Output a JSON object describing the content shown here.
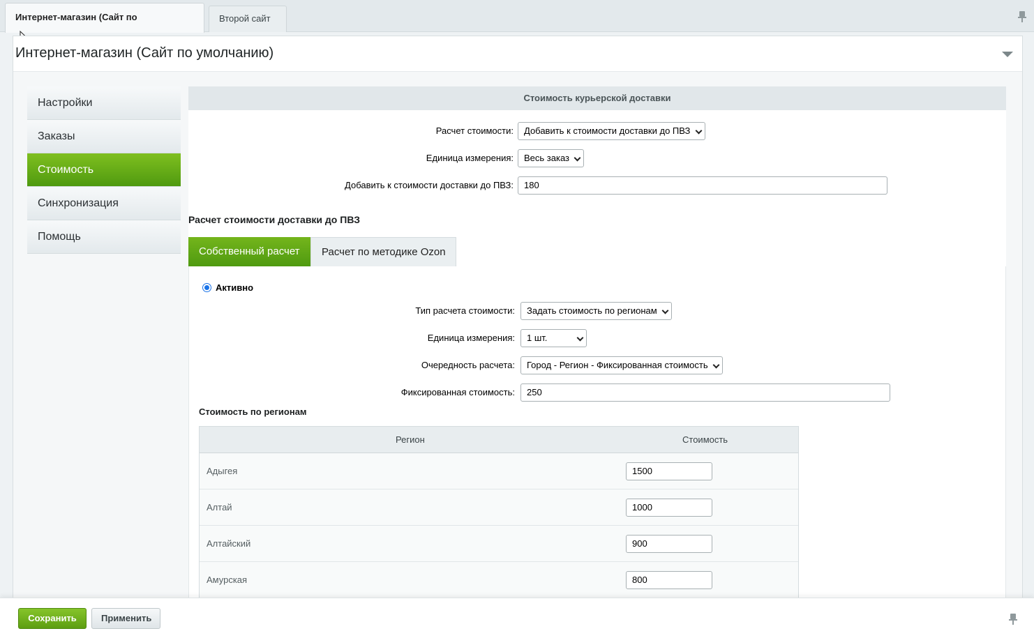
{
  "site_tabs": [
    {
      "label": "Интернет-магазин (Сайт по умолчанию)",
      "active": true
    },
    {
      "label": "Второй сайт",
      "active": false
    }
  ],
  "panel": {
    "title": "Интернет-магазин (Сайт по умолчанию)"
  },
  "side_menu": [
    {
      "label": "Настройки"
    },
    {
      "label": "Заказы"
    },
    {
      "label": "Стоимость",
      "active": true
    },
    {
      "label": "Синхронизация"
    },
    {
      "label": "Помощь"
    }
  ],
  "courier": {
    "title": "Стоимость курьерской доставки",
    "calc_label": "Расчет стоимости:",
    "calc_value": "Добавить к стоимости доставки до ПВЗ",
    "unit_label": "Единица измерения:",
    "unit_value": "Весь заказ",
    "add_label": "Добавить к стоимости доставки до ПВЗ:",
    "add_value": "180"
  },
  "pvz": {
    "title": "Расчет стоимости доставки до ПВЗ",
    "tabs": [
      {
        "label": "Собственный расчет",
        "active": true
      },
      {
        "label": "Расчет по методике Ozon",
        "active": false
      }
    ],
    "active_label": "Активно",
    "type_label": "Тип расчета стоимости:",
    "type_value": "Задать стоимость по регионам",
    "unit_label": "Единица измерения:",
    "unit_value": "1 шт.",
    "order_label": "Очередность расчета:",
    "order_value": "Город - Регион - Фиксированная стоимость",
    "fixed_label": "Фиксированная стоимость:",
    "fixed_value": "250",
    "regions_title": "Стоимость по регионам",
    "table": {
      "headers": [
        "Регион",
        "Стоимость"
      ],
      "rows": [
        {
          "region": "Адыгея",
          "cost": "1500"
        },
        {
          "region": "Алтай",
          "cost": "1000"
        },
        {
          "region": "Алтайский",
          "cost": "900"
        },
        {
          "region": "Амурская",
          "cost": "800"
        }
      ]
    }
  },
  "footer": {
    "save_label": "Сохранить",
    "apply_label": "Применить"
  }
}
